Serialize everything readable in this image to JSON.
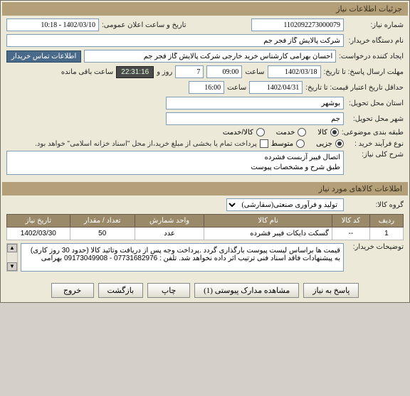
{
  "sections": {
    "info_header": "جزئیات اطلاعات نیاز",
    "items_header": "اطلاعات کالاهای مورد نیاز"
  },
  "fields": {
    "req_no_label": "شماره نیاز:",
    "req_no": "1102092273000079",
    "announce_label": "تاریخ و ساعت اعلان عمومی:",
    "announce": "1402/03/10 - 10:18",
    "buyer_label": "نام دستگاه خریدار:",
    "buyer": "شرکت پالایش گاز فجر جم",
    "creator_label": "ایجاد کننده درخواست:",
    "creator": "احسان بهرامی کارشناس خرید خارجی شرکت پالایش گاز فجر جم",
    "contact_btn": "اطلاعات تماس خریدار",
    "deadline_label": "مهلت ارسال پاسخ: تا تاریخ:",
    "deadline_date": "1402/03/18",
    "time_label": "ساعت",
    "deadline_h": "09:00",
    "day_label": "روز و",
    "day_val": "7",
    "remaining_time": "22:31:16",
    "remaining_suffix": "ساعت باقی مانده",
    "validity_label": "حداقل تاریخ اعتبار قیمت: تا تاریخ:",
    "validity_date": "1402/04/31",
    "validity_time": "16:00",
    "province_label": "استان محل تحویل:",
    "province": "بوشهر",
    "city_label": "شهر محل تحویل:",
    "city": "جم",
    "category_label": "طبقه بندی موضوعی:",
    "cat_goods": "کالا",
    "cat_service": "خدمت",
    "cat_goods_service": "کالا/خدمت",
    "process_label": "نوع فرآیند خرید :",
    "proc_minor": "جزیی",
    "proc_medium": "متوسط",
    "payment_note": "پرداخت تمام یا بخشی از مبلغ خرید،از محل \"اسناد خزانه اسلامی\" خواهد بود.",
    "summary_label": "شرح کلی نیاز:",
    "summary_line1": "اتصال فیبر آزبست فشرده",
    "summary_line2": "طبق شرح و مشخصات پیوست",
    "group_label": "گروه کالا:",
    "group_value": "تولید و فرآوری صنعتی(سفارشی)",
    "buyer_desc_label": "توضیحات خریدار:",
    "buyer_desc": "قیمت ها براساس لیست پیوست بارگذاری گردد .پرداخت وجه پس از دریافت وتائید کالا (حدود 30 روز کاری) به پیشنهادات فاقد اسناد فنی ترتیب اثر داده نخواهد شد. تلفن : 07731682976 - 09173049908 بهرامی"
  },
  "table": {
    "headers": {
      "row": "ردیف",
      "code": "کد کالا",
      "name": "نام کالا",
      "unit": "واحد شمارش",
      "qty": "تعداد / مقدار",
      "date": "تاریخ نیاز"
    },
    "rows": [
      {
        "n": "1",
        "code": "--",
        "name": "گسکت دایکات فیبر فشرده",
        "unit": "عدد",
        "qty": "50",
        "date": "1402/03/30"
      }
    ]
  },
  "buttons": {
    "respond": "پاسخ به نیاز",
    "attachments": "مشاهده مدارک پیوستی (1)",
    "print": "چاپ",
    "back": "بازگشت",
    "exit": "خروج"
  }
}
